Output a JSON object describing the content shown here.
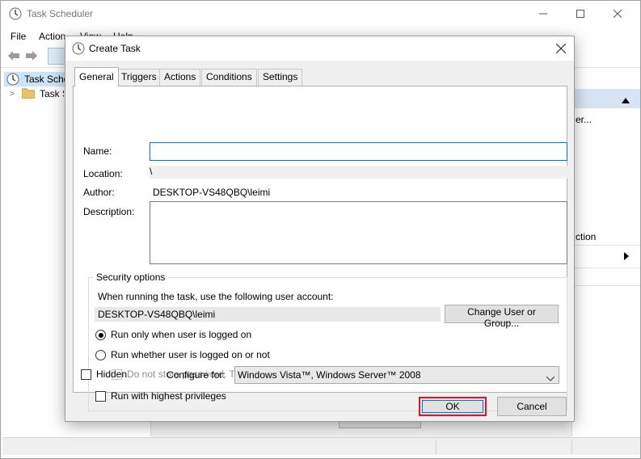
{
  "main_window": {
    "title": "Task Scheduler",
    "menu": [
      "File",
      "Action",
      "View",
      "Help"
    ],
    "tree": {
      "root_label": "Task Scheduler (Local)",
      "child_label": "Task Scheduler Library"
    },
    "actions_fragments": [
      "er...",
      "ction"
    ]
  },
  "dialog": {
    "title": "Create Task",
    "tabs": [
      "General",
      "Triggers",
      "Actions",
      "Conditions",
      "Settings"
    ],
    "fields": {
      "name_label": "Name:",
      "name_value": "",
      "location_label": "Location:",
      "location_value": "\\",
      "author_label": "Author:",
      "author_value": "DESKTOP-VS48QBQ\\leimi",
      "description_label": "Description:",
      "description_value": ""
    },
    "security": {
      "legend": "Security options",
      "account_prompt": "When running the task, use the following user account:",
      "account_value": "DESKTOP-VS48QBQ\\leimi",
      "change_button": "Change User or Group...",
      "radio_logged_on": "Run only when user is logged on",
      "radio_whether": "Run whether user is logged on or not",
      "no_store_password": "Do not store password.  The task will only have access to local computer resources.",
      "highest_privileges": "Run with highest privileges"
    },
    "hidden_label": "Hidden",
    "configure_label": "Configure for:",
    "configure_value": "Windows Vista™, Windows Server™ 2008",
    "ok_label": "OK",
    "cancel_label": "Cancel"
  },
  "colors": {
    "accent": "#0078d7",
    "highlight_border": "#e81123",
    "actions_header": "#d6e4f4"
  }
}
